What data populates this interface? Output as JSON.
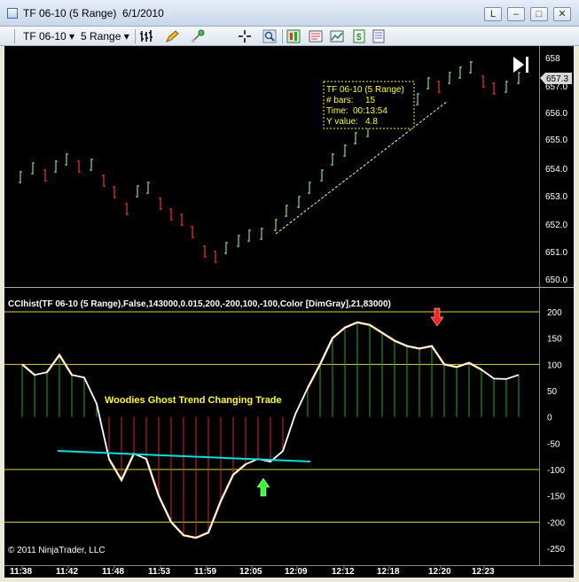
{
  "window": {
    "title": "TF 06-10 (5 Range)  6/1/2010",
    "buttons": [
      "L",
      "–",
      "□",
      "✕"
    ]
  },
  "toolbar": {
    "instrument": "TF 06-10",
    "interval": "5 Range",
    "icons": [
      "bar-type-icon",
      "pencil-icon",
      "zoom-icon",
      "crosshair-icon",
      "magnifier-icon",
      "chart-trader-icon",
      "data-box-icon",
      "properties-icon",
      "strategy-icon",
      "indicator-list-icon"
    ]
  },
  "price_panel": {
    "current_price": "657.3",
    "axis_labels": [
      "658",
      "657.0",
      "656.0",
      "655.0",
      "654.0",
      "653.0",
      "652.0",
      "651.0",
      "650.0"
    ],
    "tooltip": {
      "title": "TF 06-10 (5 Range)",
      "bars_label": "# bars:",
      "bars_value": "15",
      "time_label": "Time:",
      "time_value": "00:13:54",
      "yvalue_label": "Y value:",
      "yvalue_value": "4.8"
    }
  },
  "indicator_panel": {
    "label": "CCIhist(TF 06-10 (5 Range),False,143000,0.015,200,-200,100,-100,Color [DimGray],21,83000)",
    "axis_labels": [
      "200",
      "150",
      "100",
      "50",
      "0",
      "-50",
      "-100",
      "-150",
      "-200",
      "-250"
    ],
    "annotation": "Woodies Ghost Trend Changing Trade",
    "copyright": "© 2011 NinjaTrader, LLC"
  },
  "time_axis": [
    "11:38",
    "11:42",
    "11:48",
    "11:53",
    "11:59",
    "12:05",
    "12:09",
    "12:12",
    "12:18",
    "12:20",
    "12:23"
  ],
  "chart_data": {
    "type": "line",
    "series": [
      {
        "values": [
          100,
          80,
          85,
          118,
          80,
          75,
          25,
          -80,
          -120,
          -70,
          -80,
          -150,
          -200,
          -225,
          -230,
          -220,
          -160,
          -110,
          -90,
          -80,
          -85,
          -65,
          5,
          55,
          100,
          150,
          170,
          180,
          175,
          160,
          145,
          135,
          130,
          135,
          100,
          95,
          103,
          90,
          73,
          72,
          80
        ]
      }
    ],
    "ylim": [
      -250,
      200
    ]
  },
  "colors": {
    "up_bar": "#7fe07f",
    "down_bar": "#ff3030",
    "cci_line": "#ffffff",
    "cci_extreme": "#ff8c00",
    "hist_green": "#22aa22",
    "hist_red": "#dd2222",
    "trendline": "#00e0e0",
    "level_line": "#d8d830",
    "annotation": "#ffff00"
  }
}
